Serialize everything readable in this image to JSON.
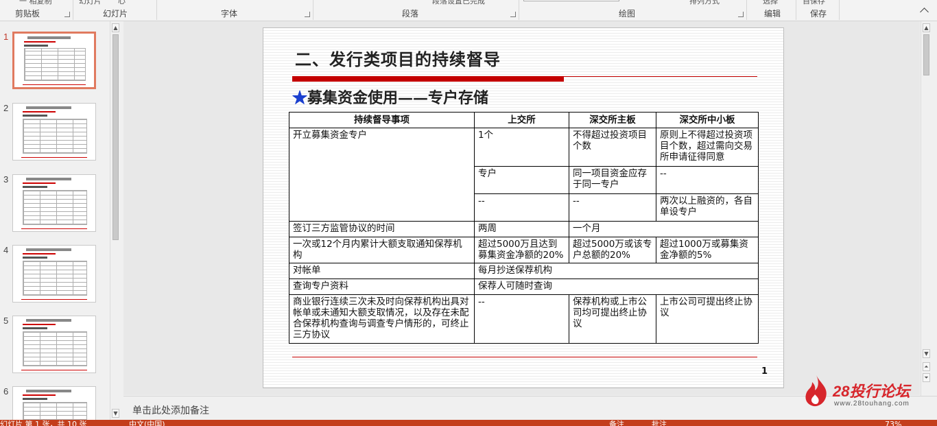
{
  "ribbon": {
    "top_fragments": [
      "一 相复制",
      "幻灯片",
      "心",
      "段落设置已完成",
      "排列方式",
      "选择",
      "自保存"
    ],
    "groups": [
      "剪贴板",
      "幻灯片",
      "字体",
      "段落",
      "绘图",
      "编辑",
      "保存"
    ]
  },
  "thumbnails": [
    {
      "number": "1",
      "active": true
    },
    {
      "number": "2",
      "active": false
    },
    {
      "number": "3",
      "active": false
    },
    {
      "number": "4",
      "active": false
    },
    {
      "number": "5",
      "active": false
    },
    {
      "number": "6",
      "active": false
    }
  ],
  "slide": {
    "title": "二、发行类项目的持续督导",
    "subtitle_star": "★",
    "subtitle": "募集资金使用——专户存储",
    "page_number": "1",
    "table": {
      "headers": [
        "持续督导事项",
        "上交所",
        "深交所主板",
        "深交所中小板"
      ],
      "r1": {
        "item": "开立募集资金专户",
        "sse": "1个",
        "szse_main": "不得超过投资项目个数",
        "szse_sme": "原则上不得超过投资项目个数，超过需向交易所申请征得同意"
      },
      "r2": {
        "sse": "专户",
        "szse_main": "同一项目资金应存于同一专户",
        "szse_sme": "--"
      },
      "r3": {
        "sse": "--",
        "szse_main": "--",
        "szse_sme": "两次以上融资的，各自单设专户"
      },
      "r4": {
        "item": "签订三方监管协议的时间",
        "sse": "两周",
        "szse": "一个月"
      },
      "r5": {
        "item": "一次或12个月内累计大额支取通知保荐机构",
        "sse": "超过5000万且达到募集资金净额的20%",
        "szse_main": "超过5000万或该专户总额的20%",
        "szse_sme": "超过1000万或募集资金净额的5%"
      },
      "r6": {
        "item": "对帐单",
        "all": "每月抄送保荐机构"
      },
      "r7": {
        "item": "查询专户资料",
        "all": "保荐人可随时查询"
      },
      "r8": {
        "item": "商业银行连续三次未及时向保荐机构出具对帐单或未通知大额支取情况，以及存在未配合保荐机构查询与调查专户情形的，可终止三方协议",
        "sse": "--",
        "szse_main": "保荐机构或上市公司均可提出终止协议",
        "szse_sme": "上市公司可提出终止协议"
      }
    }
  },
  "notes": {
    "placeholder": "单击此处添加备注"
  },
  "statusbar": {
    "slide_info": "幻灯片 第 1 张，共 10 张",
    "language": "中文(中国)",
    "notes_btn": "备注",
    "comments_btn": "批注",
    "zoom": "73%"
  },
  "watermark": {
    "brand": "28投行论坛",
    "url": "www.28touhang.com"
  },
  "colors": {
    "accent": "#c43e1c",
    "title_red": "#c40000",
    "star_blue": "#1a3fcf"
  }
}
